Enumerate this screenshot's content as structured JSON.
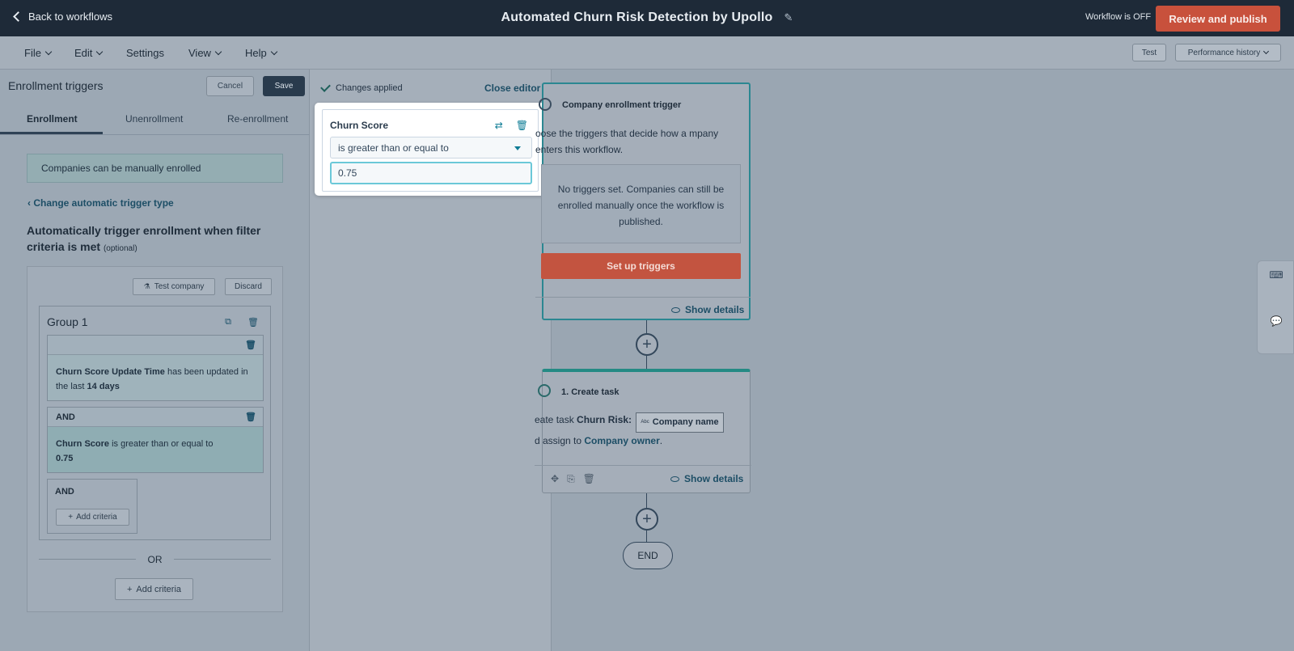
{
  "topbar": {
    "back_label": "Back to workflows",
    "workflow_title": "Automated Churn Risk Detection by Upollo",
    "status": "Workflow is OFF",
    "publish_label": "Review and publish"
  },
  "menubar": {
    "items": [
      "File",
      "Edit",
      "Settings",
      "View",
      "Help"
    ],
    "test_label": "Test",
    "performance_label": "Performance history"
  },
  "left_panel": {
    "title": "Enrollment triggers",
    "cancel_label": "Cancel",
    "save_label": "Save",
    "tabs": [
      "Enrollment",
      "Unenrollment",
      "Re-enrollment"
    ],
    "active_tab": "Enrollment",
    "manual_notice": "Companies can be manually enrolled",
    "change_trigger_label": "Change automatic trigger type",
    "auto_title": "Automatically trigger enrollment when filter criteria is met",
    "auto_title_optional": "(optional)",
    "test_company_label": "Test company",
    "discard_label": "Discard",
    "group": {
      "title": "Group 1",
      "criteria": [
        {
          "property": "Churn Score Update Time",
          "text": "has been updated in the last",
          "value": "14 days"
        },
        {
          "header": "AND",
          "property": "Churn Score",
          "text": "is greater than or equal to",
          "value": "0.75"
        }
      ],
      "and_label": "AND",
      "add_criteria_label": "Add criteria"
    },
    "or_label": "OR",
    "add_criteria_label": "Add criteria"
  },
  "editor": {
    "changes_label": "Changes applied",
    "close_label": "Close editor",
    "property_title": "Churn Score",
    "operator": "is greater than or equal to",
    "value": "0.75"
  },
  "canvas": {
    "trigger_card": {
      "title": "Company enrollment trigger",
      "description": "oose the triggers that decide how a mpany enters this workflow.",
      "empty_text": "No triggers set. Companies can still be enrolled manually once the workflow is published.",
      "setup_label": "Set up triggers",
      "show_details_label": "Show details"
    },
    "task_card": {
      "title": "1. Create task",
      "desc_prefix": "eate task",
      "task_name": "Churn Risk:",
      "chip_tag": "Abc",
      "chip_label": "Company name",
      "assign_prefix": "d assign to",
      "assign_link": "Company owner",
      "period": ".",
      "show_details_label": "Show details"
    },
    "end_label": "END"
  },
  "colors": {
    "accent_orange": "#c8513c",
    "teal_border": "#2b8791",
    "link": "#1d4e66",
    "editor_accent": "#0e7c95"
  }
}
